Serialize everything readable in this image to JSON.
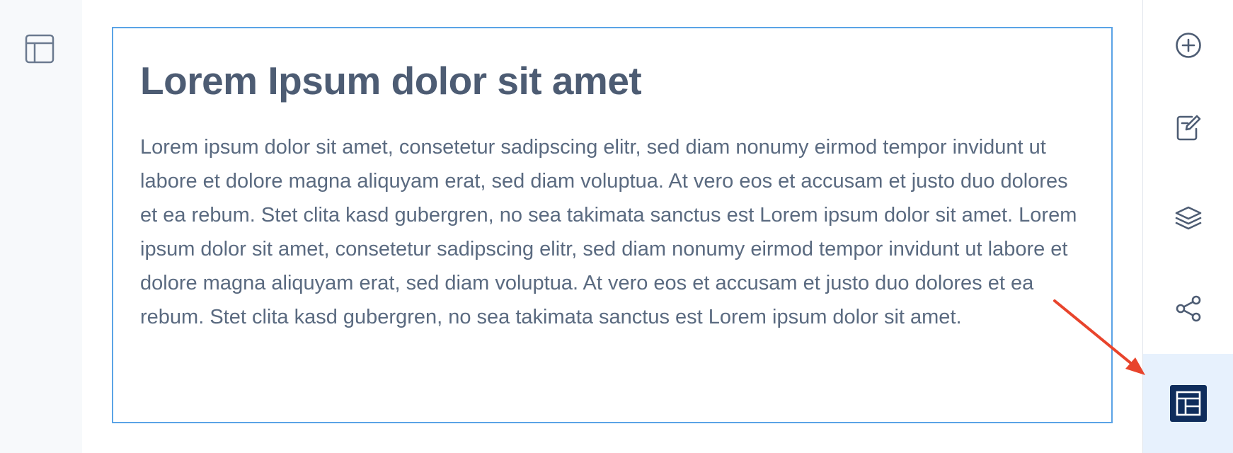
{
  "left_rail": {
    "icon": "layout-panel-icon"
  },
  "text_block": {
    "title": "Lorem Ipsum dolor sit amet",
    "body": "Lorem ipsum dolor sit amet, consetetur sadipscing elitr, sed diam nonumy eirmod tempor invidunt ut labore et dolore magna aliquyam erat, sed diam voluptua. At vero eos et accusam et justo duo dolores et ea rebum. Stet clita kasd gubergren, no sea takimata sanctus est Lorem ipsum dolor sit amet. Lorem ipsum dolor sit amet, consetetur sadipscing elitr, sed diam nonumy eirmod tempor invidunt ut labore et dolore magna aliquyam erat, sed diam voluptua. At vero eos et accusam et justo duo dolores et ea rebum. Stet clita kasd gubergren, no sea takimata sanctus est Lorem ipsum dolor sit amet."
  },
  "right_toolbar": {
    "items": [
      {
        "icon": "plus-circle-icon",
        "active": false
      },
      {
        "icon": "edit-note-icon",
        "active": false
      },
      {
        "icon": "layers-icon",
        "active": false
      },
      {
        "icon": "share-icon",
        "active": false
      },
      {
        "icon": "layout-grid-icon",
        "active": true
      }
    ]
  },
  "colors": {
    "accent_border": "#5aa3e6",
    "text_title": "#4d5c73",
    "text_body": "#5a6a80",
    "icon": "#4d5c73",
    "active_bg": "#e7f1fd",
    "active_icon_bg": "#0f2d5c",
    "annotation_arrow": "#e8442c"
  }
}
